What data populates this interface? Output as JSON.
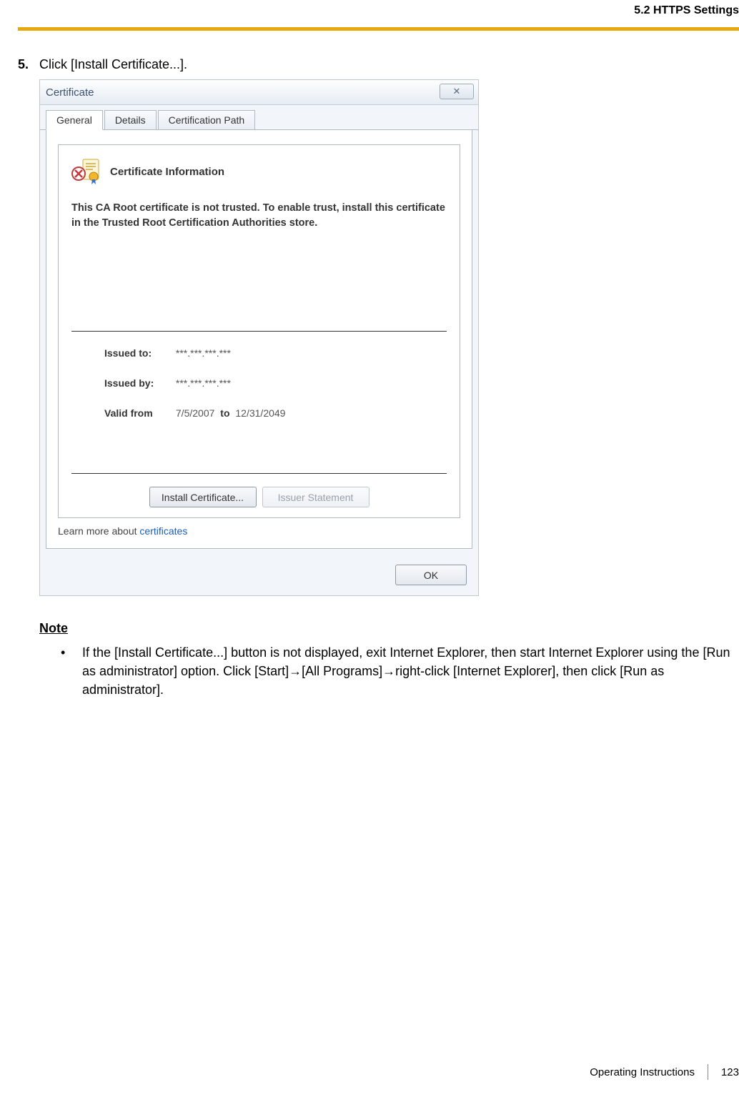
{
  "header": {
    "section_title": "5.2 HTTPS Settings"
  },
  "step": {
    "number": "5.",
    "text": "Click [Install Certificate...]."
  },
  "dialog": {
    "title": "Certificate",
    "close_glyph": "✕",
    "tabs": [
      "General",
      "Details",
      "Certification Path"
    ],
    "info_title": "Certificate Information",
    "trust_message": "This CA Root certificate is not trusted. To enable trust, install this certificate in the Trusted Root Certification Authorities store.",
    "issued_to_label": "Issued to:",
    "issued_to_value": "***.***.***.***",
    "issued_by_label": "Issued by:",
    "issued_by_value": "***.***.***.***",
    "valid_from_label": "Valid from",
    "valid_from_value": "7/5/2007",
    "valid_to_word": "to",
    "valid_to_value": "12/31/2049",
    "install_btn": "Install Certificate...",
    "issuer_btn": "Issuer Statement",
    "learn_prefix": "Learn more about ",
    "learn_link": "certificates",
    "ok_btn": "OK"
  },
  "note": {
    "heading": "Note",
    "bullet": "•",
    "text": "If the [Install Certificate...] button is not displayed, exit Internet Explorer, then start Internet Explorer using the [Run as administrator] option. Click [Start]→[All Programs]→right-click [Internet Explorer], then click [Run as administrator]."
  },
  "footer": {
    "doc": "Operating Instructions",
    "page": "123"
  }
}
